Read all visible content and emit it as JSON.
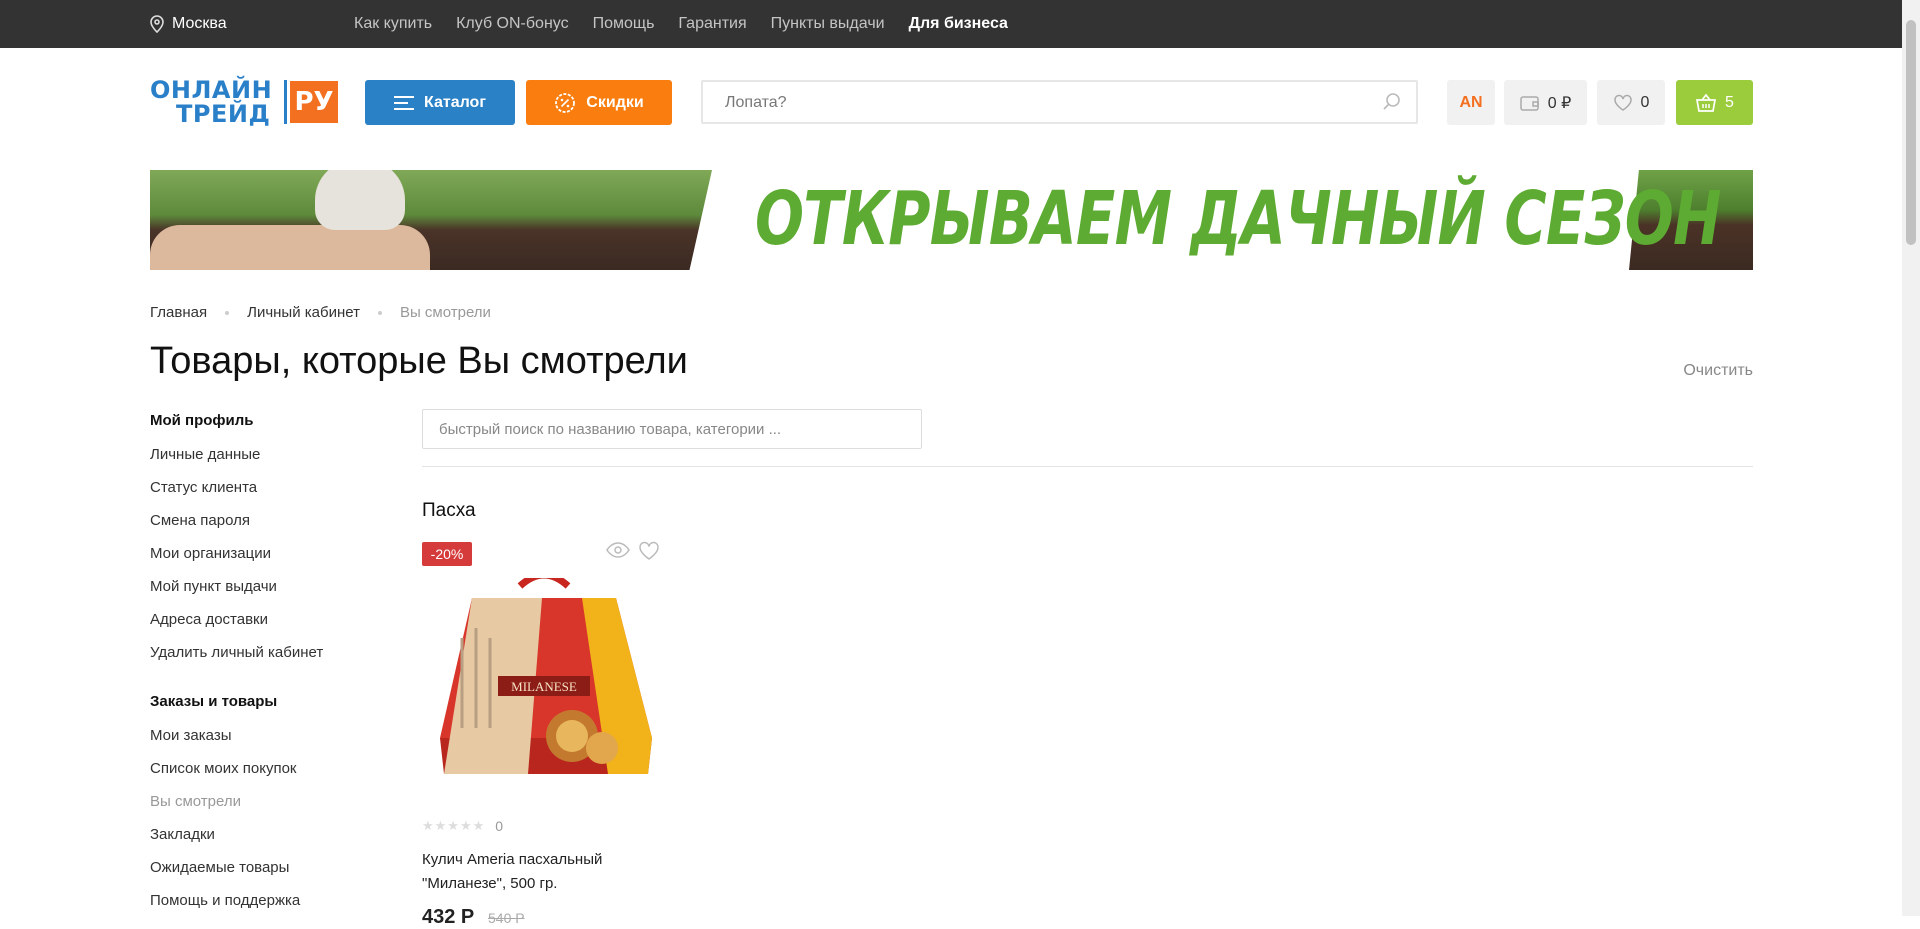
{
  "topbar": {
    "city": "Москва",
    "links": [
      "Как купить",
      "Клуб ON-бонус",
      "Помощь",
      "Гарантия",
      "Пункты выдачи"
    ],
    "business": "Для бизнеса"
  },
  "logo": {
    "line1": "ОНЛАЙН",
    "line2": "ТРЕЙД",
    "suffix": "РУ"
  },
  "header": {
    "catalog": "Каталог",
    "sale": "Скидки",
    "search_placeholder": "Лопата?",
    "user_initials": "AN",
    "wallet": "0 ₽",
    "favorites": "0",
    "cart": "5"
  },
  "banner": {
    "text": "ОТКРЫВАЕМ ДАЧНЫЙ СЕЗОН"
  },
  "breadcrumbs": [
    "Главная",
    "Личный кабинет",
    "Вы смотрели"
  ],
  "page": {
    "title": "Товары, которые Вы смотрели",
    "clear": "Очистить"
  },
  "sidebar": {
    "profile_title": "Мой профиль",
    "profile_items": [
      "Личные данные",
      "Статус клиента",
      "Смена пароля",
      "Мои организации",
      "Мой пункт выдачи",
      "Адреса доставки",
      "Удалить личный кабинет"
    ],
    "orders_title": "Заказы и товары",
    "orders_items": [
      "Мои заказы",
      "Список моих покупок",
      "Вы смотрели",
      "Закладки",
      "Ожидаемые товары",
      "Помощь и поддержка"
    ]
  },
  "content": {
    "quick_search_placeholder": "быстрый поиск по названию товара, категории ...",
    "group": "Пасха",
    "product": {
      "discount": "-20%",
      "rating_count": "0",
      "name": "Кулич Ameria пасхальный \"Миланезе\", 500 гр.",
      "price": "432 Р",
      "old_price": "540 Р",
      "brand_on_image": "MILANESE"
    }
  },
  "colors": {
    "topbar": "#333333",
    "catalog": "#2b81c6",
    "sale": "#f97e0f",
    "cart": "#9bcc3c",
    "banner_text": "#5dab32",
    "badge": "#d63b3b"
  }
}
